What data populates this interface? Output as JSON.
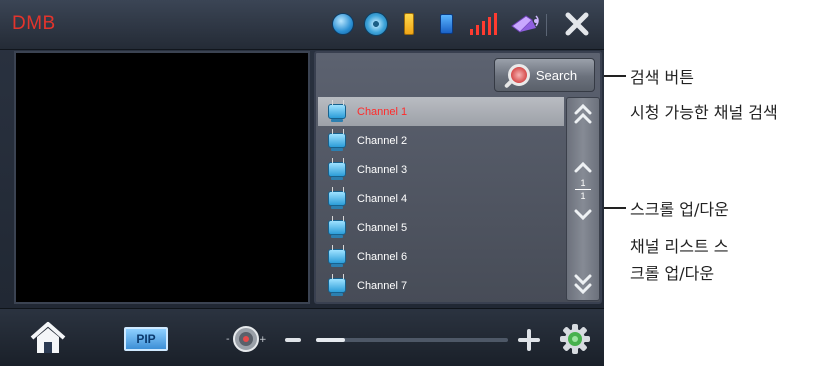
{
  "app": {
    "title": "DMB"
  },
  "status_icons": [
    "globe-icon",
    "disc-icon",
    "battery-icon",
    "card-icon",
    "signal-icon",
    "satellite-icon"
  ],
  "search": {
    "label": "Search"
  },
  "channels": [
    {
      "name": "Channel 1",
      "selected": true
    },
    {
      "name": "Channel 2",
      "selected": false
    },
    {
      "name": "Channel 3",
      "selected": false
    },
    {
      "name": "Channel 4",
      "selected": false
    },
    {
      "name": "Channel 5",
      "selected": false
    },
    {
      "name": "Channel 6",
      "selected": false
    },
    {
      "name": "Channel 7",
      "selected": false
    }
  ],
  "page_indicator": {
    "current": "1",
    "total": "1"
  },
  "bottom": {
    "pip_label": "PIP",
    "volume_level": 0.15
  },
  "annotations": {
    "search_title": "검색 버튼",
    "search_desc": "시청 가능한 채널 검색",
    "scroll_title": "스크롤 업/다운",
    "scroll_desc_line1": "채널 리스트 스",
    "scroll_desc_line2": "크롤 업/다운"
  },
  "colors": {
    "accent_red": "#e3342c",
    "selected_text": "#ff2b2b",
    "signal_red": "#ff3b30"
  }
}
